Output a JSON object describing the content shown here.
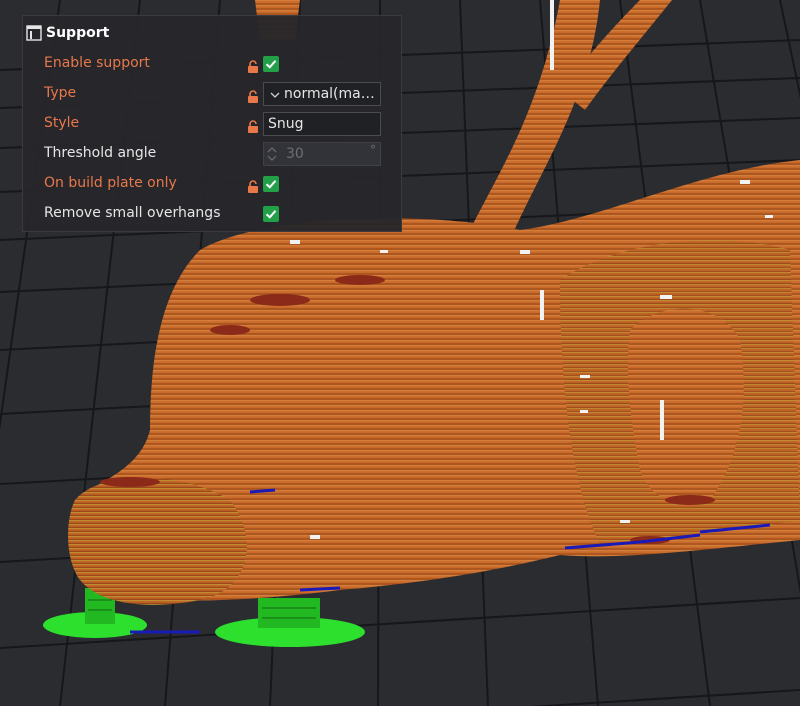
{
  "panel": {
    "title": "Support",
    "icon": "support-panel-icon"
  },
  "settings": [
    {
      "label": "Enable support",
      "modified": true,
      "locked": true,
      "control": "checkbox",
      "checked": true
    },
    {
      "label": "Type",
      "modified": true,
      "locked": true,
      "control": "combo",
      "value": "normal(man..."
    },
    {
      "label": "Style",
      "modified": true,
      "locked": true,
      "control": "text",
      "value": "Snug"
    },
    {
      "label": "Threshold angle",
      "modified": false,
      "locked": false,
      "control": "spin",
      "value": "30",
      "unit": "°",
      "disabled": true
    },
    {
      "label": "On build plate only",
      "modified": true,
      "locked": true,
      "control": "checkbox",
      "checked": true
    },
    {
      "label": "Remove small overhangs",
      "modified": false,
      "locked": false,
      "control": "checkbox",
      "checked": true
    }
  ],
  "colors": {
    "modified_label": "#e8784a",
    "checkbox": "#22a047",
    "model": "#c8692a",
    "support": "#2ee02e",
    "plate": "#2b2c30"
  }
}
